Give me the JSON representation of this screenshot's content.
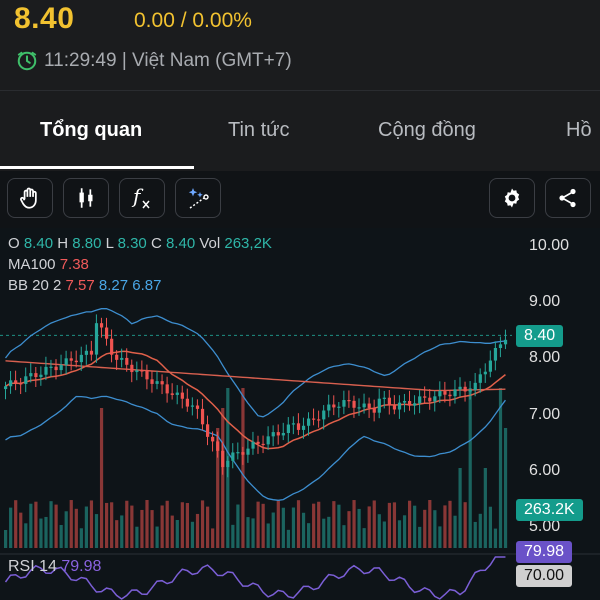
{
  "header": {
    "price": "8.40",
    "change": "0.00 / 0.00%",
    "time_text": "11:29:49 | Việt Nam (GMT+7)"
  },
  "tabs": [
    {
      "label": "Tổng quan",
      "active": true
    },
    {
      "label": "Tin tức",
      "active": false
    },
    {
      "label": "Cộng đồng",
      "active": false
    },
    {
      "label": "Hồ",
      "active": false
    }
  ],
  "toolbar": {
    "left_icons": [
      "hand-icon",
      "candlestick-icon",
      "function-icon",
      "magic-draw-icon"
    ],
    "right_icons": [
      "gear-icon",
      "share-icon"
    ],
    "fx_text": "f"
  },
  "chart": {
    "legend": {
      "o_label": "O",
      "o_value": "8.40",
      "h_label": "H",
      "h_value": "8.80",
      "l_label": "L",
      "l_value": "8.30",
      "c_label": "C",
      "c_value": "8.40",
      "vol_label": "Vol",
      "vol_value": "263,2K",
      "ma_label": "MA100",
      "ma_value": "7.38",
      "bb_label": "BB 20 2",
      "bb_upper": "7.57",
      "bb_mid": "8.27",
      "bb_lower": "6.87"
    },
    "y_axis_labels": [
      "10.00",
      "9.00",
      "8.00",
      "7.00",
      "6.00",
      "5.00"
    ],
    "price_tag": "8.40",
    "volume_tag": "263.2K",
    "rsi": {
      "label": "RSI 14",
      "value": "79.98",
      "tag_value": "79.98",
      "level_tag": "70.00"
    },
    "colors": {
      "up": "#26a69a",
      "down": "#ef5350",
      "bb": "#3d8ecf",
      "ma": "#e0604a",
      "rsi": "#7b5fd6",
      "accent": "#f2c230"
    }
  },
  "chart_data": {
    "type": "candlestick",
    "y_axis_labels": [
      "10.00",
      "9.00",
      "8.00",
      "7.00",
      "6.00",
      "5.00"
    ],
    "last": {
      "open": 8.4,
      "high": 8.8,
      "low": 8.3,
      "close": 8.4,
      "volume": "263,2K"
    },
    "indicators": {
      "MA100": 7.38,
      "BB_20_2": {
        "upper": 7.57,
        "middle": 8.27,
        "lower": 6.87
      },
      "RSI_14": 79.98
    }
  }
}
